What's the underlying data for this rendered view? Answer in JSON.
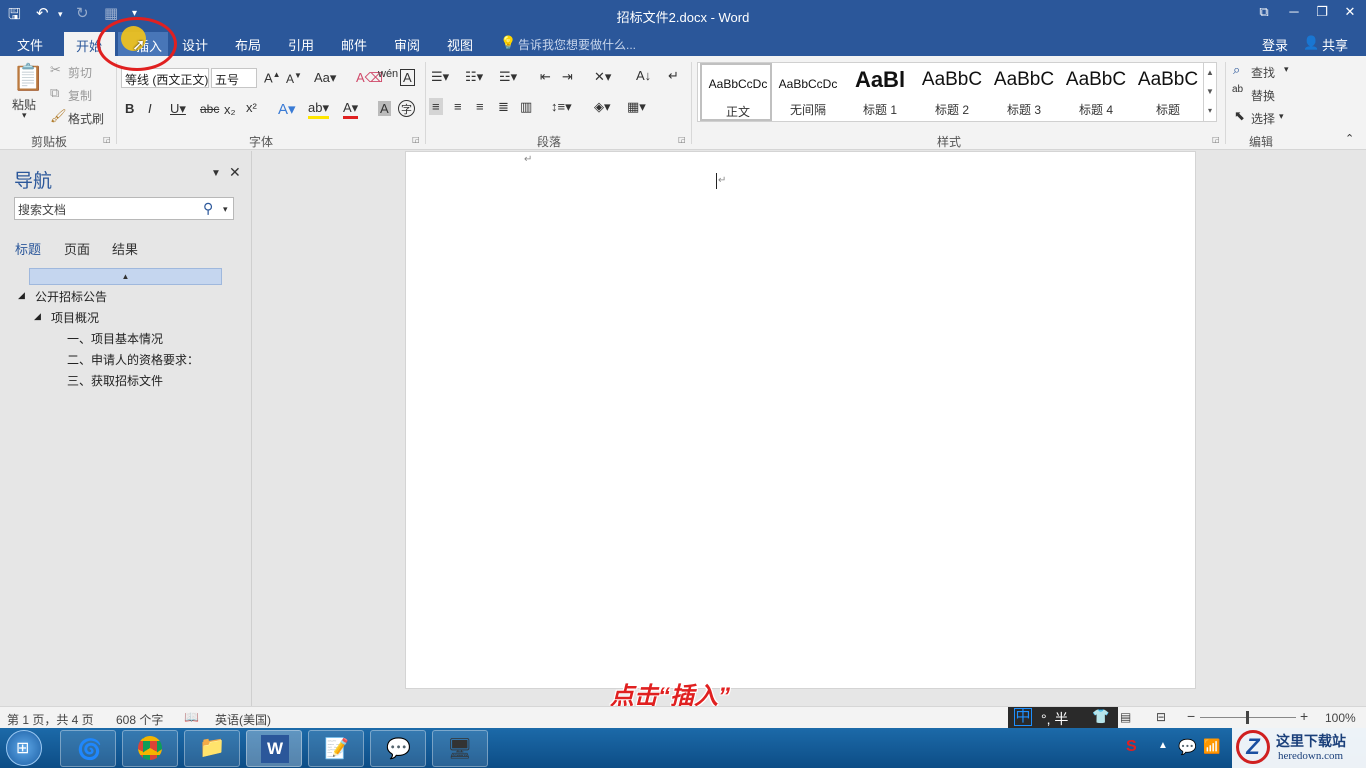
{
  "title_bar": {
    "document_title": "招标文件2.docx - Word"
  },
  "menu": {
    "tabs": [
      "文件",
      "开始",
      "插入",
      "设计",
      "布局",
      "引用",
      "邮件",
      "审阅",
      "视图"
    ],
    "tell_me": "告诉我您想要做什么...",
    "login": "登录",
    "share": "共享"
  },
  "ribbon": {
    "clipboard": {
      "paste": "粘贴",
      "cut": "剪切",
      "copy": "复制",
      "format_painter": "格式刷",
      "group": "剪贴板"
    },
    "font": {
      "font_name": "等线 (西文正文)",
      "font_size": "五号",
      "group": "字体"
    },
    "paragraph": {
      "group": "段落"
    },
    "styles": {
      "group": "样式",
      "items": [
        {
          "preview": "AaBbCcDc",
          "name": "正文"
        },
        {
          "preview": "AaBbCcDc",
          "name": "无间隔"
        },
        {
          "preview": "AaBl",
          "name": "标题 1"
        },
        {
          "preview": "AaBbC",
          "name": "标题 2"
        },
        {
          "preview": "AaBbC",
          "name": "标题 3"
        },
        {
          "preview": "AaBbC",
          "name": "标题 4"
        },
        {
          "preview": "AaBbC",
          "name": "标题"
        }
      ]
    },
    "editing": {
      "find": "查找",
      "replace": "替换",
      "select": "选择",
      "group": "编辑"
    }
  },
  "nav": {
    "title": "导航",
    "search_placeholder": "搜索文档",
    "tabs": [
      "标题",
      "页面",
      "结果"
    ],
    "tree": [
      {
        "level": 1,
        "text": "公开招标公告"
      },
      {
        "level": 2,
        "text": "项目概况"
      },
      {
        "level": 3,
        "text": "一、项目基本情况"
      },
      {
        "level": 3,
        "text": "二、申请人的资格要求："
      },
      {
        "level": 3,
        "text": "三、获取招标文件"
      }
    ]
  },
  "overlay": {
    "hint": "点击“插入”"
  },
  "status": {
    "page": "第 1 页，共 4 页",
    "words": "608 个字",
    "language": "英语(美国)",
    "ime": "中 °, 半",
    "zoom": "100%"
  },
  "watermark": {
    "site": "这里下载站",
    "url": "heredown.com"
  },
  "colors": {
    "accent": "#2b579a",
    "annotation_red": "#e02020"
  }
}
